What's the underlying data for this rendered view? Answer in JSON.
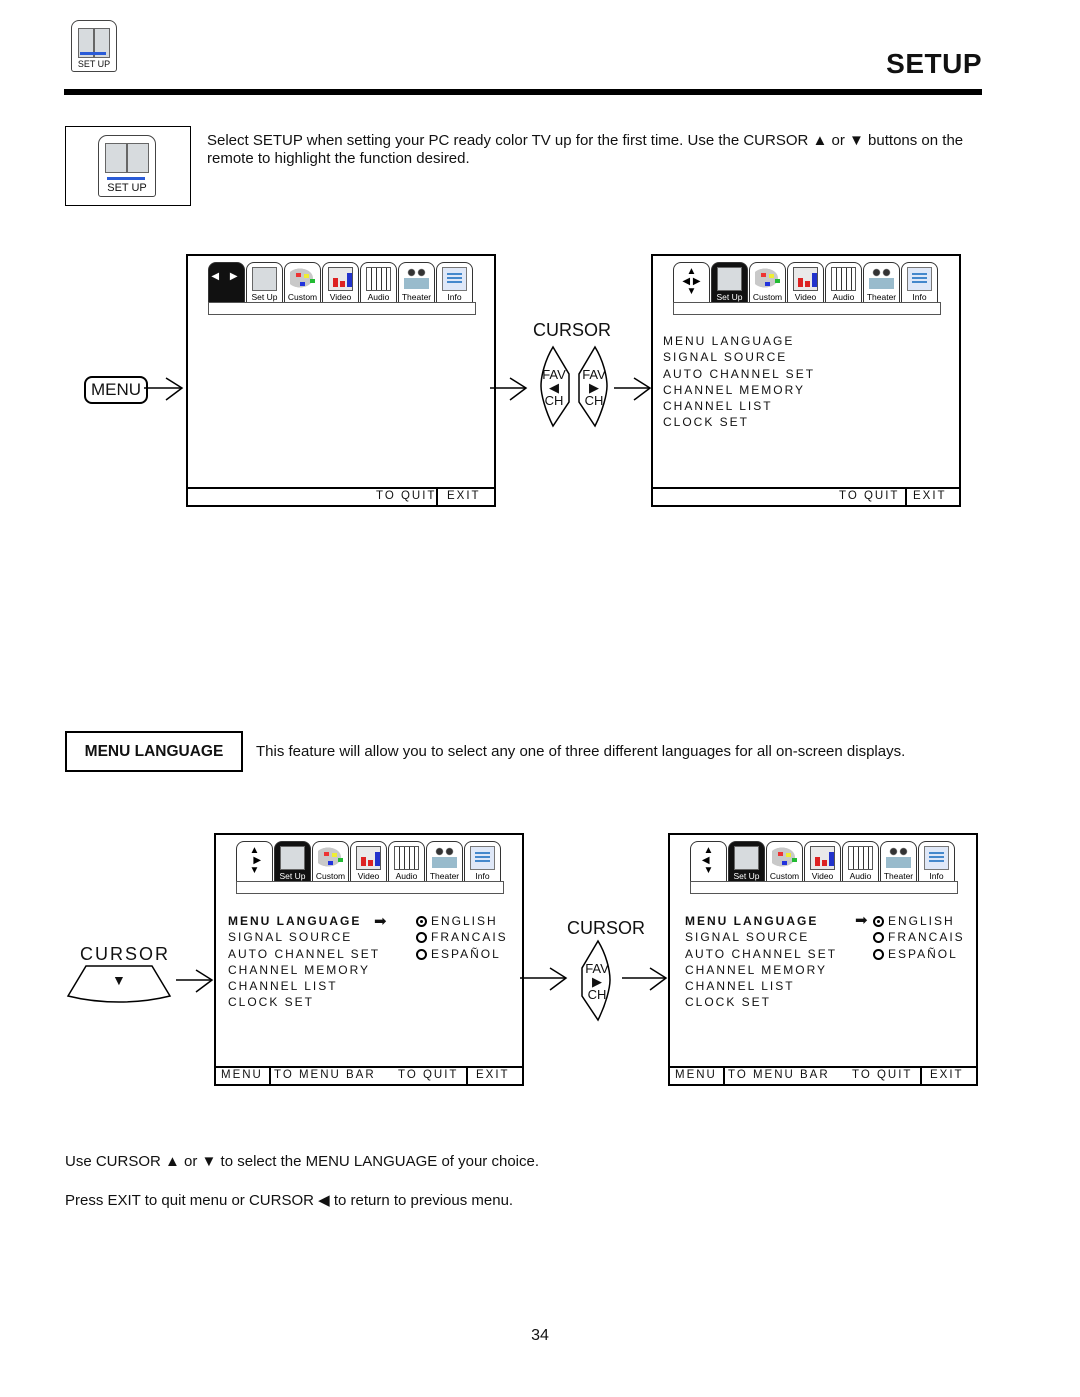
{
  "header": {
    "icon_label": "SET UP",
    "title": "SETUP"
  },
  "intro": {
    "icon_label": "SET UP",
    "text": "Select SETUP when setting your PC ready color TV up for the first time.  Use the CURSOR ▲ or ▼ buttons on the remote to highlight the function desired."
  },
  "tabs": [
    {
      "label": "Set Up",
      "icon": "setup-icon"
    },
    {
      "label": "Custom",
      "icon": "palette-icon"
    },
    {
      "label": "Video",
      "icon": "video-icon"
    },
    {
      "label": "Audio",
      "icon": "audio-icon"
    },
    {
      "label": "Theater",
      "icon": "theater-icon"
    },
    {
      "label": "Info",
      "icon": "info-icon"
    }
  ],
  "diagram1": {
    "menu_button": "MENU",
    "cursor_label": "CURSOR",
    "fav_left": {
      "top": "FAV",
      "arrow": "◀",
      "bottom": "CH"
    },
    "fav_right": {
      "top": "FAV",
      "arrow": "▶",
      "bottom": "CH"
    },
    "screen1_nav": "◀ ▶",
    "screen1_footer": {
      "to_quit": "TO QUIT",
      "exit": "EXIT"
    },
    "screen2_items": [
      "MENU LANGUAGE",
      "SIGNAL SOURCE",
      "AUTO CHANNEL SET",
      "CHANNEL MEMORY",
      "CHANNEL LIST",
      "CLOCK SET"
    ],
    "screen2_footer": {
      "to_quit": "TO QUIT",
      "exit": "EXIT"
    }
  },
  "section": {
    "title": "MENU LANGUAGE",
    "description": "This feature will allow you to select any one of three different languages for all on-screen displays."
  },
  "diagram2": {
    "cursor_left_label": "CURSOR",
    "cursor_left_arrow": "▼",
    "cursor_mid_label": "CURSOR",
    "fav_mid": {
      "top": "FAV",
      "arrow": "▶",
      "bottom": "CH"
    },
    "items": [
      "MENU LANGUAGE",
      "SIGNAL SOURCE",
      "AUTO CHANNEL SET",
      "CHANNEL MEMORY",
      "CHANNEL LIST",
      "CLOCK SET"
    ],
    "options": [
      {
        "label": "ENGLISH",
        "selected": true
      },
      {
        "label": "FRANCAIS",
        "selected": false
      },
      {
        "label": "ESPAÑOL",
        "selected": false
      }
    ],
    "footer": {
      "menu": "MENU",
      "to_menu_bar": "TO MENU BAR",
      "to_quit": "TO QUIT",
      "exit": "EXIT"
    }
  },
  "instructions": [
    "Use CURSOR ▲ or ▼ to select the MENU LANGUAGE of your choice.",
    "Press EXIT to quit menu or CURSOR ◀ to return to previous menu."
  ],
  "page_number": "34"
}
